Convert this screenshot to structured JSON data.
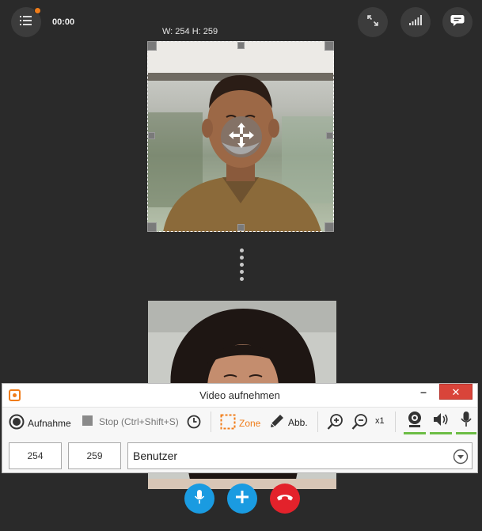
{
  "header": {
    "timer": "00:00",
    "selection_size": "W: 254 H: 259"
  },
  "icons": {
    "menu": "list-icon",
    "fullscreen": "expand-icon",
    "signal": "signal-bars-icon",
    "chat": "chat-bubble-icon",
    "move": "move-arrows-icon"
  },
  "recorder": {
    "title": "Video aufnehmen",
    "minimize": "–",
    "close": "✕",
    "record_label": "Aufnahme",
    "stop_label": "Stop (Ctrl+Shift+S)",
    "zone_label": "Zone",
    "draw_label": "Abb.",
    "zoom_label": "x1",
    "width_value": "254",
    "height_value": "259",
    "source_value": "Benutzer"
  },
  "colors": {
    "accent": "#f07d1a",
    "mic_button": "#1a9be1",
    "add_button": "#1a9be1",
    "end_call_button": "#e3222b",
    "level_meter": "#6cbd45"
  }
}
